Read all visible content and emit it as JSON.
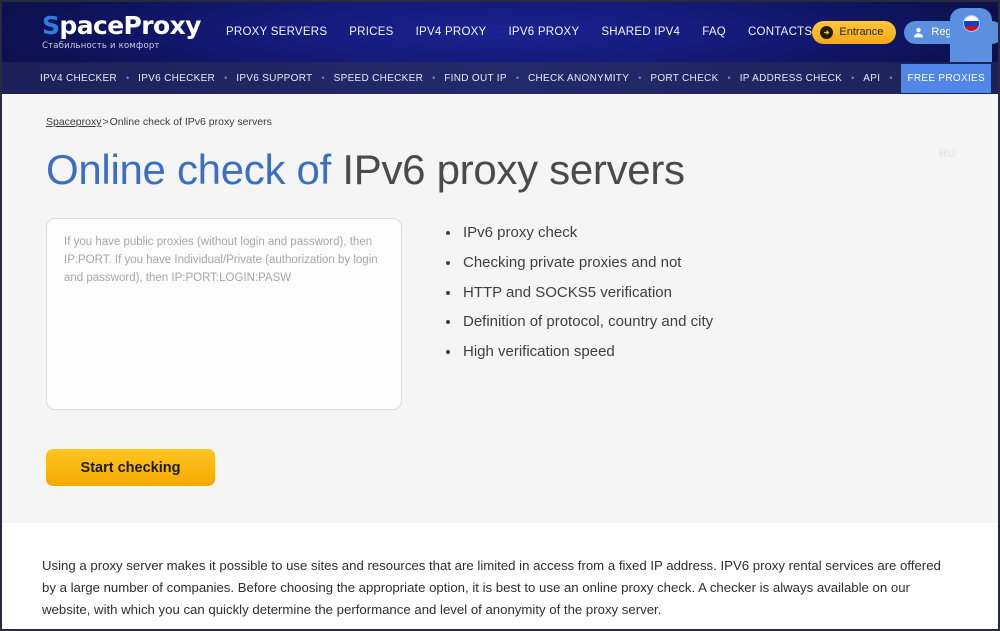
{
  "brand": {
    "name_lead": "S",
    "name_rest": "paceProxy",
    "tagline": "Стабильность и комфорт",
    "accent_color": "#2f7de1"
  },
  "header": {
    "nav": [
      {
        "label": "PROXY SERVERS"
      },
      {
        "label": "PRICES"
      },
      {
        "label": "IPV4 PROXY"
      },
      {
        "label": "IPV6 PROXY"
      },
      {
        "label": "SHARED IPV4"
      },
      {
        "label": "FAQ"
      },
      {
        "label": "CONTACTS"
      }
    ],
    "entrance_label": "Entrance",
    "registration_label": "Registration",
    "entrance_color": "#f7a81b",
    "registration_color": "#5b8fe0",
    "language_flag": "ru-flag-icon"
  },
  "subnav": {
    "separator": "•",
    "items": [
      {
        "label": "IPV4 CHECKER",
        "highlighted": false
      },
      {
        "label": "IPV6 CHECKER",
        "highlighted": false
      },
      {
        "label": "IPV6 SUPPORT",
        "highlighted": false
      },
      {
        "label": "SPEED CHECKER",
        "highlighted": false
      },
      {
        "label": "FIND OUT IP",
        "highlighted": false
      },
      {
        "label": "CHECK ANONYMITY",
        "highlighted": false
      },
      {
        "label": "PORT CHECK",
        "highlighted": false
      },
      {
        "label": "IP ADDRESS CHECK",
        "highlighted": false
      },
      {
        "label": "API",
        "highlighted": false
      },
      {
        "label": "FREE PROXIES",
        "highlighted": true
      }
    ]
  },
  "breadcrumb": {
    "root": "Spaceproxy",
    "separator": ">",
    "current": "Online check of IPv6 proxy servers"
  },
  "hero": {
    "title_accent": "Online check of",
    "title_rest": " IPv6 proxy servers",
    "title_accent_color": "#3b6fc4",
    "textarea_placeholder": "If you have public proxies (without login and password), then IP:PORT. If you have Individual/Private (authorization by login and password), then IP:PORT:LOGIN:PASW",
    "textarea_value": "",
    "start_button_label": "Start checking",
    "features": [
      "IPv6 proxy check",
      "Checking private proxies and not",
      "HTTP and SOCKS5 verification",
      "Definition of protocol, country and city",
      "High verification speed"
    ],
    "language_code": "RU"
  },
  "bottom": {
    "paragraph": "Using a proxy server makes it possible to use sites and resources that are limited in access from a fixed IP address. IPV6 proxy rental services are offered by a large number of companies. Before choosing the appropriate option, it is best to use an online proxy check. A checker is always available on our website, with which you can quickly determine the performance and level of anonymity of the proxy server."
  }
}
